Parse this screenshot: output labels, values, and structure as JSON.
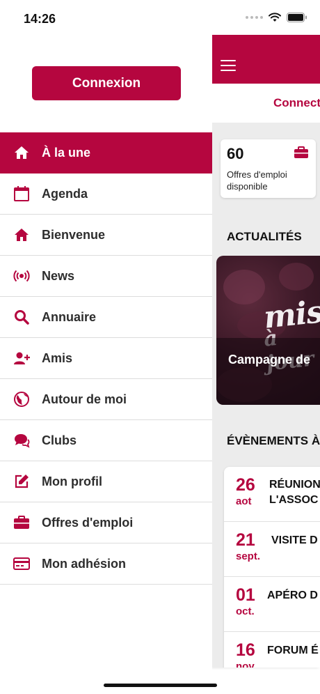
{
  "status_bar": {
    "time": "14:26"
  },
  "drawer": {
    "login_label": "Connexion",
    "menu": [
      {
        "label": "À la une",
        "icon": "home-icon",
        "active": true
      },
      {
        "label": "Agenda",
        "icon": "calendar-icon"
      },
      {
        "label": "Bienvenue",
        "icon": "home-icon"
      },
      {
        "label": "News",
        "icon": "broadcast-icon"
      },
      {
        "label": "Annuaire",
        "icon": "search-icon"
      },
      {
        "label": "Amis",
        "icon": "add-user-icon"
      },
      {
        "label": "Autour de moi",
        "icon": "globe-icon"
      },
      {
        "label": "Clubs",
        "icon": "chat-bubbles-icon"
      },
      {
        "label": "Mon profil",
        "icon": "edit-icon"
      },
      {
        "label": "Offres d'emploi",
        "icon": "briefcase-icon"
      },
      {
        "label": "Mon adhésion",
        "icon": "credit-card-icon"
      }
    ]
  },
  "main": {
    "connect_strip": "Connect",
    "stat": {
      "value": "60",
      "label": "Offres d'emploi disponible"
    },
    "news_title": "ACTUALITÉS",
    "news_card": {
      "overlay_word_1": "mise",
      "overlay_word_2": "à jour",
      "caption": "Campagne de"
    },
    "events_title": "ÉVÈNEMENTS À",
    "events": [
      {
        "day": "26",
        "month": "aot",
        "title_line1": "RÉUNION",
        "title_line2": "L'ASSOC"
      },
      {
        "day": "21",
        "month": "sept.",
        "title_line1": "VISITE D",
        "title_line2": ""
      },
      {
        "day": "01",
        "month": "oct.",
        "title_line1": "APÉRO D",
        "title_line2": ""
      },
      {
        "day": "16",
        "month": "nov.",
        "title_line1": "FORUM É",
        "title_line2": ""
      }
    ]
  },
  "colors": {
    "brand": "#b5063f",
    "background": "#ececec"
  }
}
